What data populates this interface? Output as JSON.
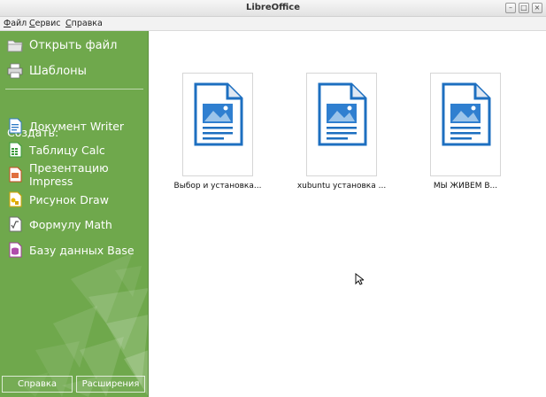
{
  "window": {
    "title": "LibreOffice"
  },
  "menu": [
    "Файл",
    "Сервис",
    "Справка"
  ],
  "sidebar": {
    "open_file": "Открыть файл",
    "templates": "Шаблоны",
    "create_label": "Создать:",
    "create_items": [
      {
        "label": "Документ Writer",
        "icon": "writer-icon",
        "color": "#2c79c6"
      },
      {
        "label": "Таблицу Calc",
        "icon": "calc-icon",
        "color": "#3a9a3a"
      },
      {
        "label": "Презентацию Impress",
        "icon": "impress-icon",
        "color": "#c94a1f"
      },
      {
        "label": "Рисунок Draw",
        "icon": "draw-icon",
        "color": "#d9a400"
      },
      {
        "label": "Формулу Math",
        "icon": "math-icon",
        "color": "#6e6e6e"
      },
      {
        "label": "Базу данных Base",
        "icon": "base-icon",
        "color": "#a33d9e"
      }
    ],
    "help_button": "Справка",
    "extensions_button": "Расширения"
  },
  "recent_documents": [
    {
      "label": "Выбор и установка...",
      "icon": "writer-document-icon"
    },
    {
      "label": "xubuntu установка ...",
      "icon": "writer-document-icon"
    },
    {
      "label": "МЫ ЖИВЕМ В...",
      "icon": "writer-document-icon"
    }
  ],
  "colors": {
    "sidebar": "#6fa84c",
    "doc_icon_blue": "#1d6fc0"
  }
}
